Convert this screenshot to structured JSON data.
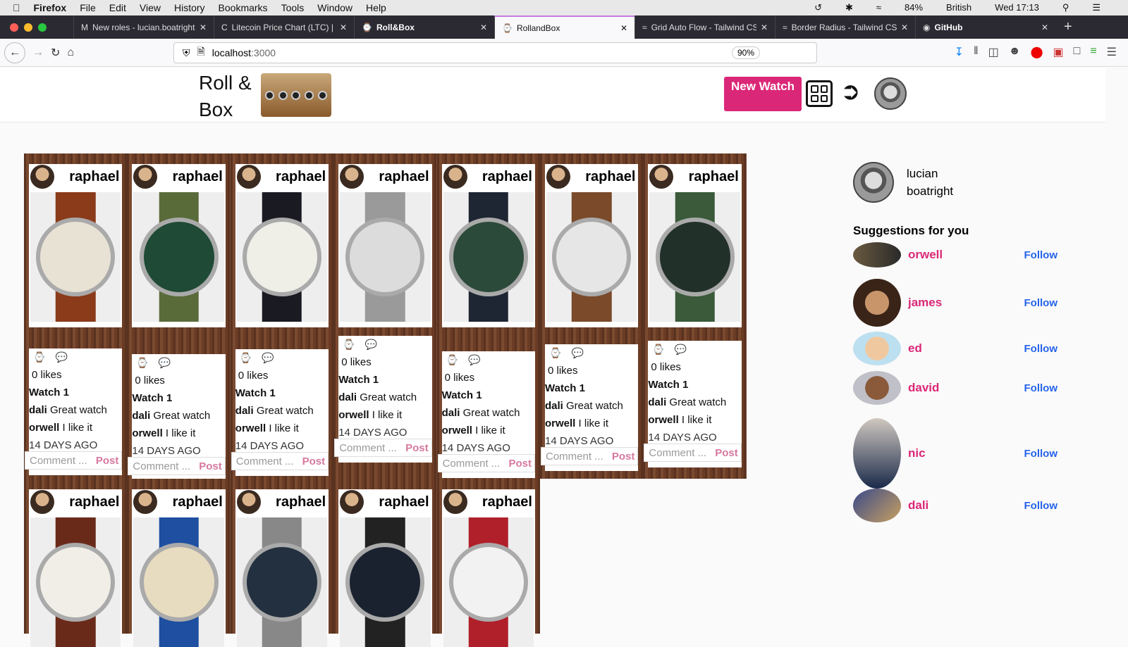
{
  "menubar": {
    "app": "Firefox",
    "items": [
      "File",
      "Edit",
      "View",
      "History",
      "Bookmarks",
      "Tools",
      "Window",
      "Help"
    ],
    "battery": "84%",
    "input": "British",
    "clock": "Wed 17:13"
  },
  "tabs": [
    {
      "title": "New roles - lucian.boatright"
    },
    {
      "title": "Litecoin Price Chart (LTC) |"
    },
    {
      "title": "Roll&Box"
    },
    {
      "title": "RollandBox",
      "active": true
    },
    {
      "title": "Grid Auto Flow - Tailwind CSS"
    },
    {
      "title": "Border Radius - Tailwind CSS"
    },
    {
      "title": "GitHub"
    }
  ],
  "url": {
    "host": "localhost",
    "port": ":3000",
    "zoom": "90%"
  },
  "header": {
    "logo_line1": "Roll &",
    "logo_line2": "Box",
    "new_watch": "New Watch"
  },
  "posts": [
    {
      "user": "raphael",
      "likes": "0 likes",
      "title": "Watch 1",
      "comments": [
        {
          "user": "dali",
          "text": "Great watch"
        },
        {
          "user": "orwell",
          "text": "I like it"
        }
      ],
      "ago": "14 DAYS AGO",
      "placeholder": "Comment ...",
      "post": "Post",
      "strap": "#8b3a1a",
      "dial": "#e8e2d4"
    },
    {
      "user": "raphael",
      "likes": "0 likes",
      "title": "Watch 1",
      "comments": [
        {
          "user": "dali",
          "text": "Great watch"
        },
        {
          "user": "orwell",
          "text": "I like it"
        }
      ],
      "ago": "14 DAYS AGO",
      "placeholder": "Comment ...",
      "post": "Post",
      "strap": "#5a6b3a",
      "dial": "#1f4a35"
    },
    {
      "user": "raphael",
      "likes": "0 likes",
      "title": "Watch 1",
      "comments": [
        {
          "user": "dali",
          "text": "Great watch"
        },
        {
          "user": "orwell",
          "text": "I like it"
        }
      ],
      "ago": "14 DAYS AGO",
      "placeholder": "Comment ...",
      "post": "Post",
      "strap": "#1a1a22",
      "dial": "#efefe8"
    },
    {
      "user": "raphael",
      "likes": "0 likes",
      "title": "Watch 1",
      "comments": [
        {
          "user": "dali",
          "text": "Great watch"
        },
        {
          "user": "orwell",
          "text": "I like it"
        }
      ],
      "ago": "14 DAYS AGO",
      "placeholder": "Comment ...",
      "post": "Post",
      "strap": "#9a9a9a",
      "dial": "#dcdcdc"
    },
    {
      "user": "raphael",
      "likes": "0 likes",
      "title": "Watch 1",
      "comments": [
        {
          "user": "dali",
          "text": "Great watch"
        },
        {
          "user": "orwell",
          "text": "I like it"
        }
      ],
      "ago": "14 DAYS AGO",
      "placeholder": "Comment ...",
      "post": "Post",
      "strap": "#1e2633",
      "dial": "#2c4a3a"
    },
    {
      "user": "raphael",
      "likes": "0 likes",
      "title": "Watch 1",
      "comments": [
        {
          "user": "dali",
          "text": "Great watch"
        },
        {
          "user": "orwell",
          "text": "I like it"
        }
      ],
      "ago": "14 DAYS AGO",
      "placeholder": "Comment ...",
      "post": "Post",
      "strap": "#7a4a2a",
      "dial": "#e6e6e6"
    },
    {
      "user": "raphael",
      "likes": "0 likes",
      "title": "Watch 1",
      "comments": [
        {
          "user": "dali",
          "text": "Great watch"
        },
        {
          "user": "orwell",
          "text": "I like it"
        }
      ],
      "ago": "14 DAYS AGO",
      "placeholder": "Comment ...",
      "post": "Post",
      "strap": "#3a5a3a",
      "dial": "#22302a"
    },
    {
      "user": "raphael",
      "strap": "#6a2a1a",
      "dial": "#f0eee6"
    },
    {
      "user": "raphael",
      "strap": "#1e4fa0",
      "dial": "#e8dcc0"
    },
    {
      "user": "raphael",
      "strap": "#888888",
      "dial": "#233040"
    },
    {
      "user": "raphael",
      "strap": "#222222",
      "dial": "#1a2230"
    },
    {
      "user": "raphael",
      "strap": "#b0202a",
      "dial": "#f2f2f2"
    }
  ],
  "sidebar": {
    "first": "lucian",
    "last": "boatright",
    "suggestions_title": "Suggestions for you",
    "suggestions": [
      {
        "name": "orwell",
        "action": "Follow"
      },
      {
        "name": "james",
        "action": "Follow"
      },
      {
        "name": "ed",
        "action": "Follow"
      },
      {
        "name": "david",
        "action": "Follow"
      },
      {
        "name": "nic",
        "action": "Follow"
      },
      {
        "name": "dali",
        "action": "Follow"
      }
    ]
  },
  "colors": {
    "accent": "#db2777",
    "follow": "#2563eb"
  }
}
